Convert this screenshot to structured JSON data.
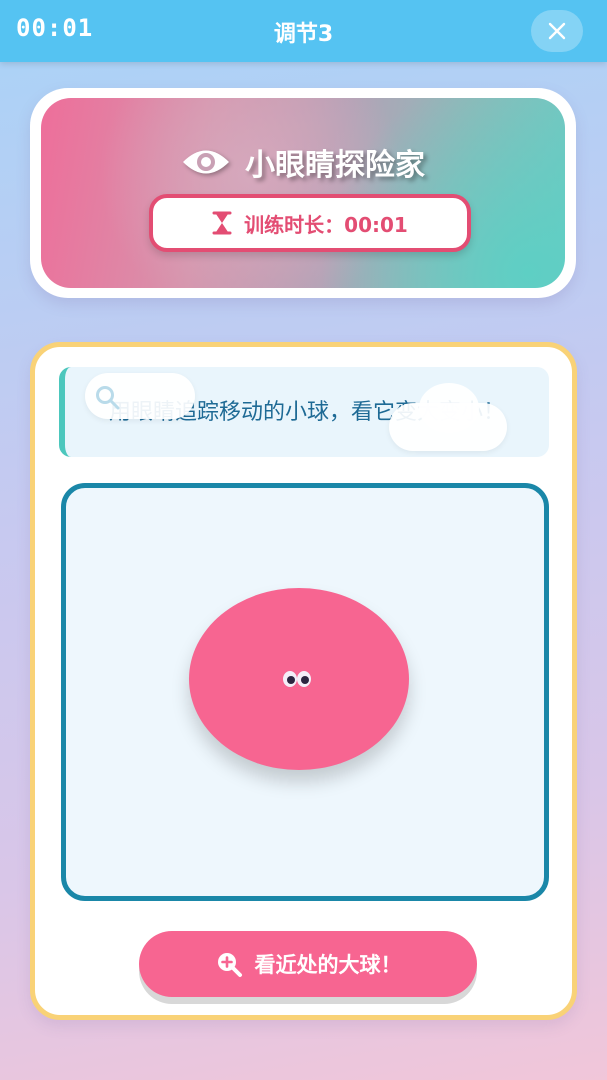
{
  "topbar": {
    "timer": "00:01",
    "title": "调节3"
  },
  "hero": {
    "title": "小眼睛探险家",
    "duration_label": "训练时长：00:01"
  },
  "instruction": {
    "text": "用眼睛追踪移动的小球，看它变大变小！"
  },
  "action": {
    "button_label": "看近处的大球！"
  },
  "colors": {
    "topbar": "#55c3f2",
    "accent_pink": "#f76591",
    "border_yellow": "#f9d277",
    "play_border": "#1a87a8"
  },
  "icons": {
    "close": "close-icon",
    "eye": "eye-icon",
    "hourglass": "hourglass-icon",
    "search": "search-icon",
    "zoom_in": "zoom-in-icon"
  }
}
